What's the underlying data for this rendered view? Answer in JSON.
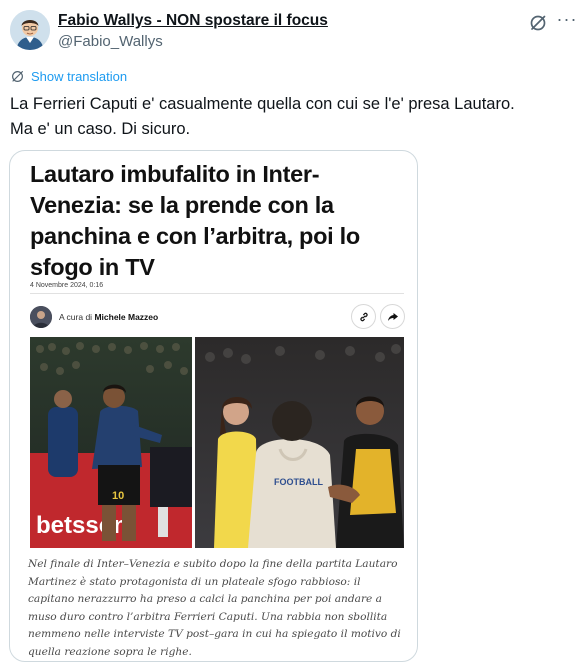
{
  "author": {
    "name": "Fabio Wallys - NON spostare il focus",
    "handle": "@Fabio_Wallys"
  },
  "icons": {
    "grok": "grok-icon",
    "more": "more-icon",
    "translate": "translate-icon",
    "link": "link-icon",
    "share": "share-icon"
  },
  "translation": {
    "label": "Show translation"
  },
  "tweet": {
    "line1": "La Ferrieri Caputi e' casualmente quella con cui se l'e' presa Lautaro.",
    "line2": "Ma e' un caso. Di sicuro."
  },
  "article": {
    "headline": "Lautaro imbufalito in Inter-Venezia: se la prende con la panchina e con l’arbitra, poi lo sfogo in TV",
    "date": "4 Novembre 2024, 0:16",
    "byline_prefix": "A cura di",
    "byline_author": "Michele Mazzeo",
    "photo_text": {
      "shirt": "FOOTBALL",
      "number": "10",
      "sponsor_board": "betsson"
    },
    "caption": "Nel finale di Inter–Venezia e subito dopo la fine della partita Lautaro Martinez è stato protagonista di un plateale sfogo rabbioso: il capitano nerazzurro ha preso a calci la panchina per poi andare a muso duro contro l’arbitra Ferrieri Caputi. Una rabbia non sbollita nemmeno nelle interviste TV post–gara in cui ha spiegato il motivo di quella reazione sopra le righe."
  },
  "colors": {
    "accent": "#1d9bf0",
    "text": "#0f1419",
    "secondary": "#536471",
    "border": "#cfd9de"
  }
}
